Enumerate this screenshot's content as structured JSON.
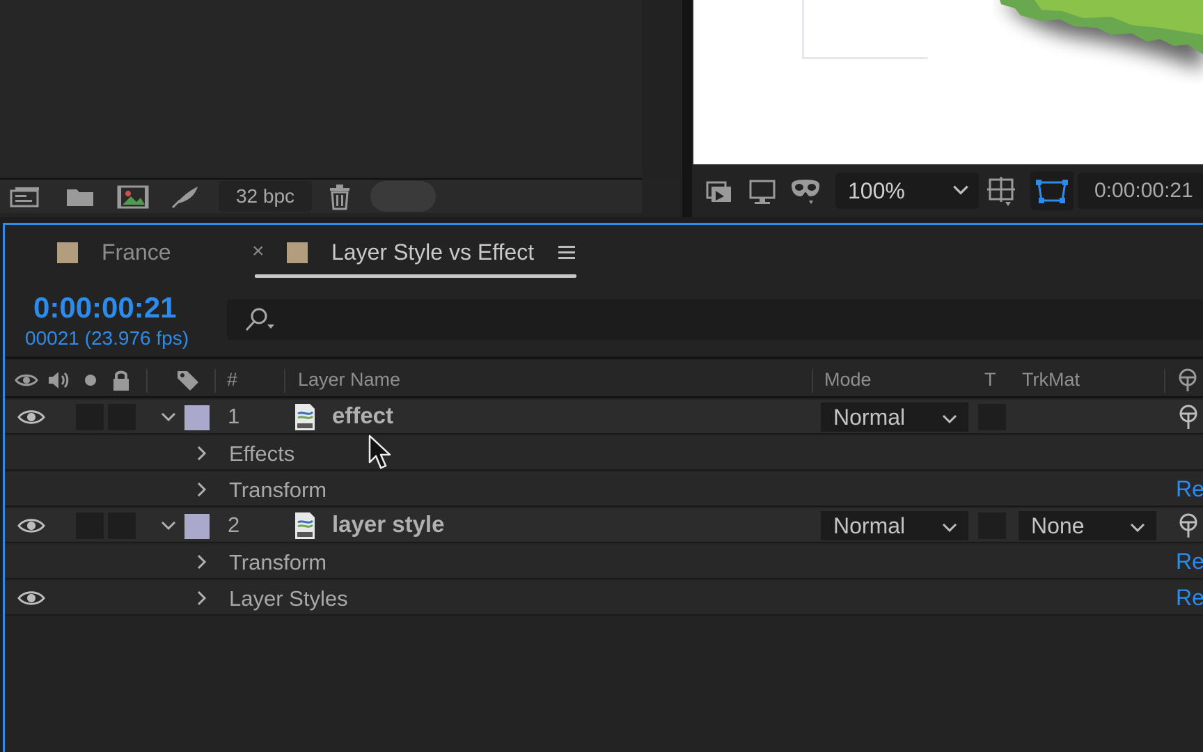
{
  "project_panel": {
    "bpc_label": "32 bpc",
    "icons": [
      "interpret-footage-icon",
      "new-folder-icon",
      "new-composition-icon",
      "render-queue-icon",
      "delete-icon"
    ]
  },
  "viewer": {
    "zoom_label": "100%",
    "timecode": "0:00:00:21",
    "icons": [
      "snapshot-icon",
      "display-icon",
      "3d-glasses-icon",
      "region-of-interest-icon",
      "mask-visibility-icon"
    ]
  },
  "timeline": {
    "tabs": [
      {
        "label": "France",
        "active": false
      },
      {
        "label": "Layer Style vs Effect",
        "active": true
      }
    ],
    "tab_close_glyph": "×",
    "current_time": "0:00:00:21",
    "frame_info": "00021 (23.976 fps)",
    "search": {
      "value": "",
      "placeholder": ""
    },
    "columns": {
      "number": "#",
      "layer_name": "Layer Name",
      "mode": "Mode",
      "t": "T",
      "trkmat": "TrkMat"
    },
    "rows": [
      {
        "kind": "layer",
        "number": "1",
        "name": "effect",
        "mode": "Normal",
        "trkmat": "",
        "expanded": true,
        "visible": true
      },
      {
        "kind": "property",
        "name": "Effects",
        "reset": ""
      },
      {
        "kind": "property",
        "name": "Transform",
        "reset": "Re"
      },
      {
        "kind": "layer",
        "number": "2",
        "name": "layer style",
        "mode": "Normal",
        "trkmat": "None",
        "expanded": true,
        "visible": true
      },
      {
        "kind": "property",
        "name": "Transform",
        "reset": "Re"
      },
      {
        "kind": "property",
        "name": "Layer Styles",
        "reset": "Re",
        "visible": true
      }
    ]
  },
  "colors": {
    "accent": "#2d8ceb",
    "label_composition": "#b29e7f",
    "label_layer": "#aaa9cc",
    "panel_bg": "#232323"
  }
}
